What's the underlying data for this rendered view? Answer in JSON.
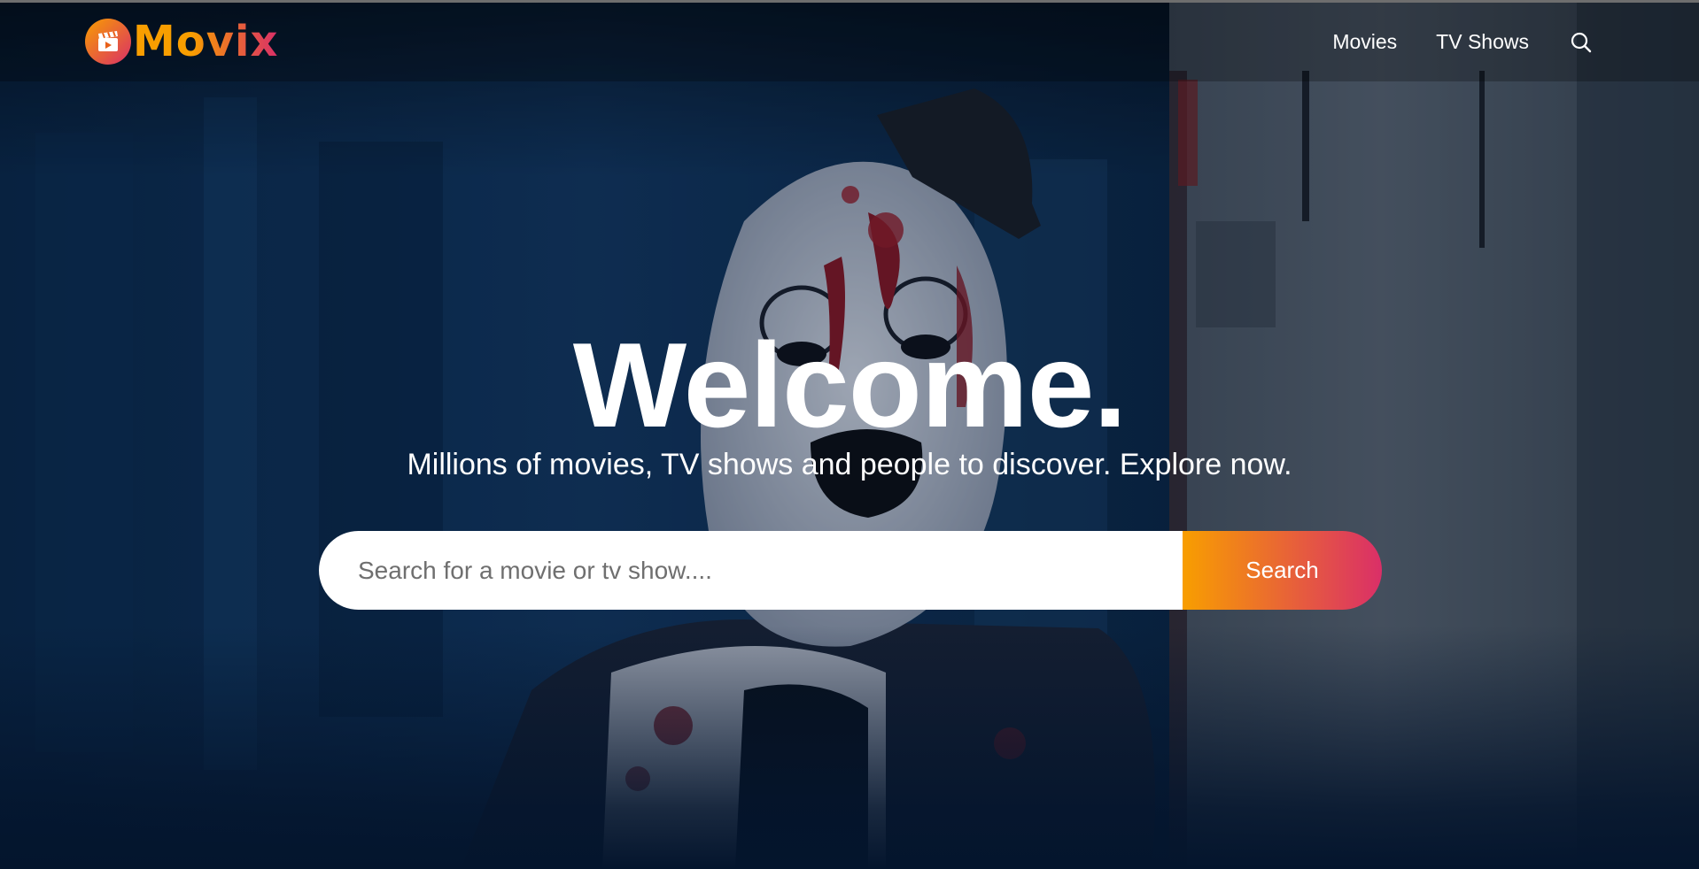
{
  "header": {
    "logo_text": "Movix",
    "nav": {
      "movies_label": "Movies",
      "tv_label": "TV Shows",
      "search_icon": "search-icon"
    }
  },
  "hero": {
    "title": "Welcome.",
    "subtitle": "Millions of movies, TV shows and people to discover. Explore now.",
    "backdrop_description": "dark horror movie still: blood-splattered clown in a small black top hat against a blue-toned wall",
    "search": {
      "placeholder": "Search for a movie or tv show....",
      "button_label": "Search"
    }
  },
  "colors": {
    "page_background": "#04152d",
    "accent_orange": "#f89e00",
    "accent_pink": "#da2f68",
    "text": "#ffffff"
  }
}
